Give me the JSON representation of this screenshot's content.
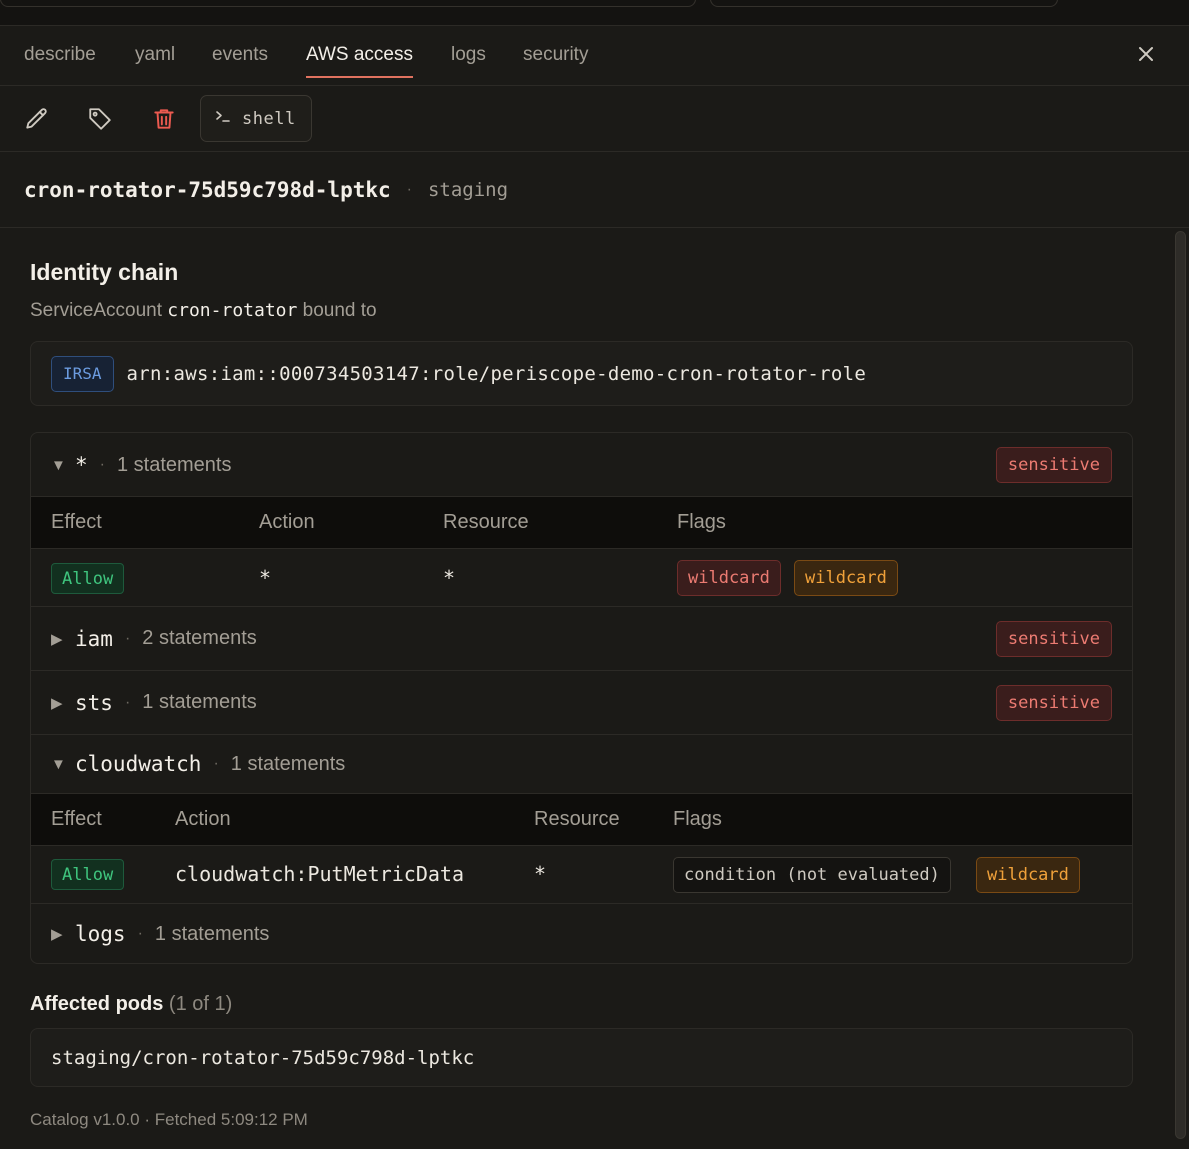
{
  "tabs": [
    {
      "label": "describe"
    },
    {
      "label": "yaml"
    },
    {
      "label": "events"
    },
    {
      "label": "AWS access"
    },
    {
      "label": "logs"
    },
    {
      "label": "security"
    }
  ],
  "active_tab": "AWS access",
  "toolbar": {
    "edit_icon": "pencil-icon",
    "tag_icon": "tag-icon",
    "delete_icon": "trash-icon",
    "shell_label": "shell"
  },
  "header": {
    "pod_name": "cron-rotator-75d59c798d-lptkc",
    "separator": "·",
    "namespace": "staging"
  },
  "identity": {
    "title": "Identity chain",
    "bound_prefix": "ServiceAccount",
    "service_account": "cron-rotator",
    "bound_suffix": "bound to",
    "badge": "IRSA",
    "arn": "arn:aws:iam::000734503147:role/periscope-demo-cron-rotator-role"
  },
  "table_headers": {
    "effect": "Effect",
    "action": "Action",
    "resource": "Resource",
    "flags": "Flags"
  },
  "services": [
    {
      "name": "*",
      "count": "1 statements",
      "expanded": true,
      "badge": "sensitive",
      "rows": [
        {
          "effect": "Allow",
          "action": "*",
          "resource": "*",
          "flags": [
            "wildcard",
            "wildcard"
          ]
        }
      ]
    },
    {
      "name": "iam",
      "count": "2 statements",
      "expanded": false,
      "badge": "sensitive"
    },
    {
      "name": "sts",
      "count": "1 statements",
      "expanded": false,
      "badge": "sensitive"
    },
    {
      "name": "cloudwatch",
      "count": "1 statements",
      "expanded": true,
      "badge": "",
      "rows": [
        {
          "effect": "Allow",
          "action": "cloudwatch:PutMetricData",
          "resource": "*",
          "flags": [
            "condition (not evaluated)",
            "wildcard"
          ]
        }
      ]
    },
    {
      "name": "logs",
      "count": "1 statements",
      "expanded": false,
      "badge": ""
    }
  ],
  "affected": {
    "title": "Affected pods",
    "count": "(1 of 1)",
    "pod": "staging/cron-rotator-75d59c798d-lptkc"
  },
  "footer": "Catalog v1.0.0 · Fetched 5:09:12 PM",
  "colors": {
    "background": "#1b1a17",
    "accent": "#e0725f",
    "sensitive": "#ec7b72",
    "allow": "#3fc57e",
    "wildcard_orange": "#f0a13a",
    "irsa_blue": "#6c9ce0"
  }
}
